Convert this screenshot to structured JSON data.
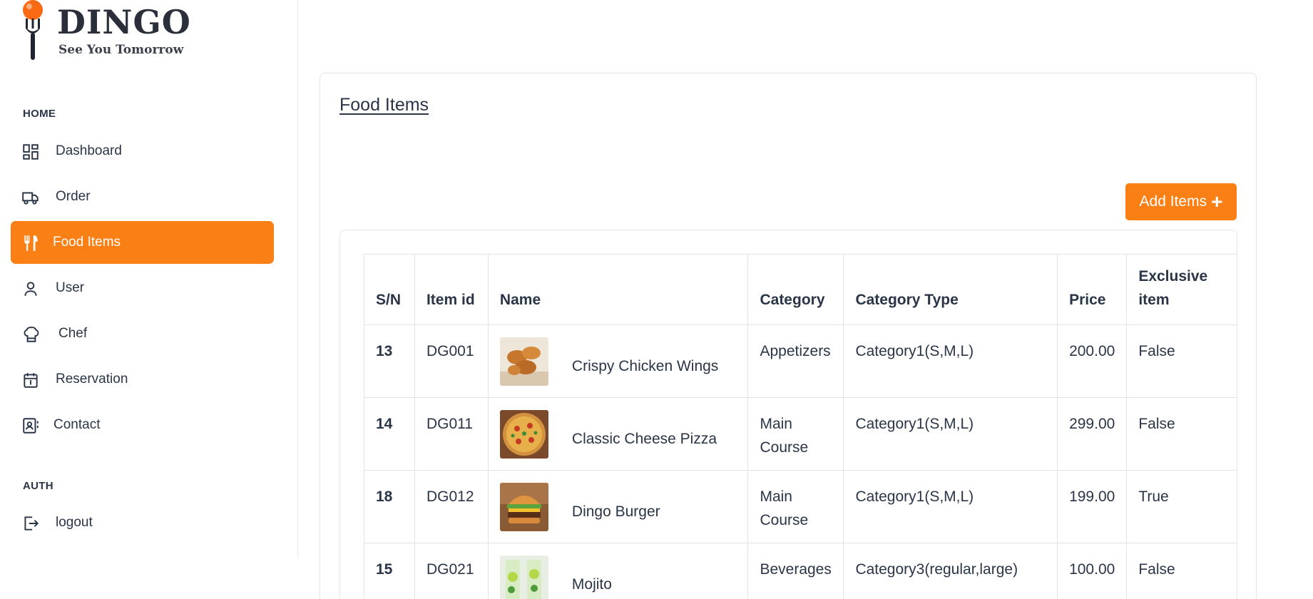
{
  "brand": {
    "name": "DINGO",
    "tagline": "See You Tomorrow",
    "accent": "#fa7f14"
  },
  "sidebar": {
    "home_label": "HOME",
    "auth_label": "AUTH",
    "items": [
      {
        "label": "Dashboard",
        "icon": "dashboard-icon"
      },
      {
        "label": "Order",
        "icon": "truck-icon"
      },
      {
        "label": "Food Items",
        "icon": "fork-knife-icon",
        "active": true
      },
      {
        "label": "User",
        "icon": "user-icon"
      },
      {
        "label": "Chef",
        "icon": "chef-hat-icon"
      },
      {
        "label": "Reservation",
        "icon": "calendar-icon"
      },
      {
        "label": "Contact",
        "icon": "contact-icon"
      }
    ],
    "logout": {
      "label": "logout",
      "icon": "logout-icon"
    }
  },
  "main": {
    "title": "Food Items",
    "add_button": "Add Items",
    "table": {
      "headers": [
        "S/N",
        "Item id",
        "Name",
        "Category",
        "Category Type",
        "Price",
        "Exclusive item"
      ],
      "rows": [
        {
          "sn": "13",
          "id": "DG001",
          "name": "Crispy Chicken Wings",
          "category": "Appetizers",
          "category_type": "Category1(S,M,L)",
          "price": "200.00",
          "exclusive": "False",
          "image": "chicken-wings-image"
        },
        {
          "sn": "14",
          "id": "DG011",
          "name": "Classic Cheese Pizza",
          "category": "Main Course",
          "category_type": "Category1(S,M,L)",
          "price": "299.00",
          "exclusive": "False",
          "image": "pizza-image"
        },
        {
          "sn": "18",
          "id": "DG012",
          "name": "Dingo Burger",
          "category": "Main Course",
          "category_type": "Category1(S,M,L)",
          "price": "199.00",
          "exclusive": "True",
          "image": "burger-image"
        },
        {
          "sn": "15",
          "id": "DG021",
          "name": "Mojito",
          "category": "Beverages",
          "category_type": "Category3(regular,large)",
          "price": "100.00",
          "exclusive": "False",
          "image": "mojito-image"
        }
      ]
    }
  }
}
